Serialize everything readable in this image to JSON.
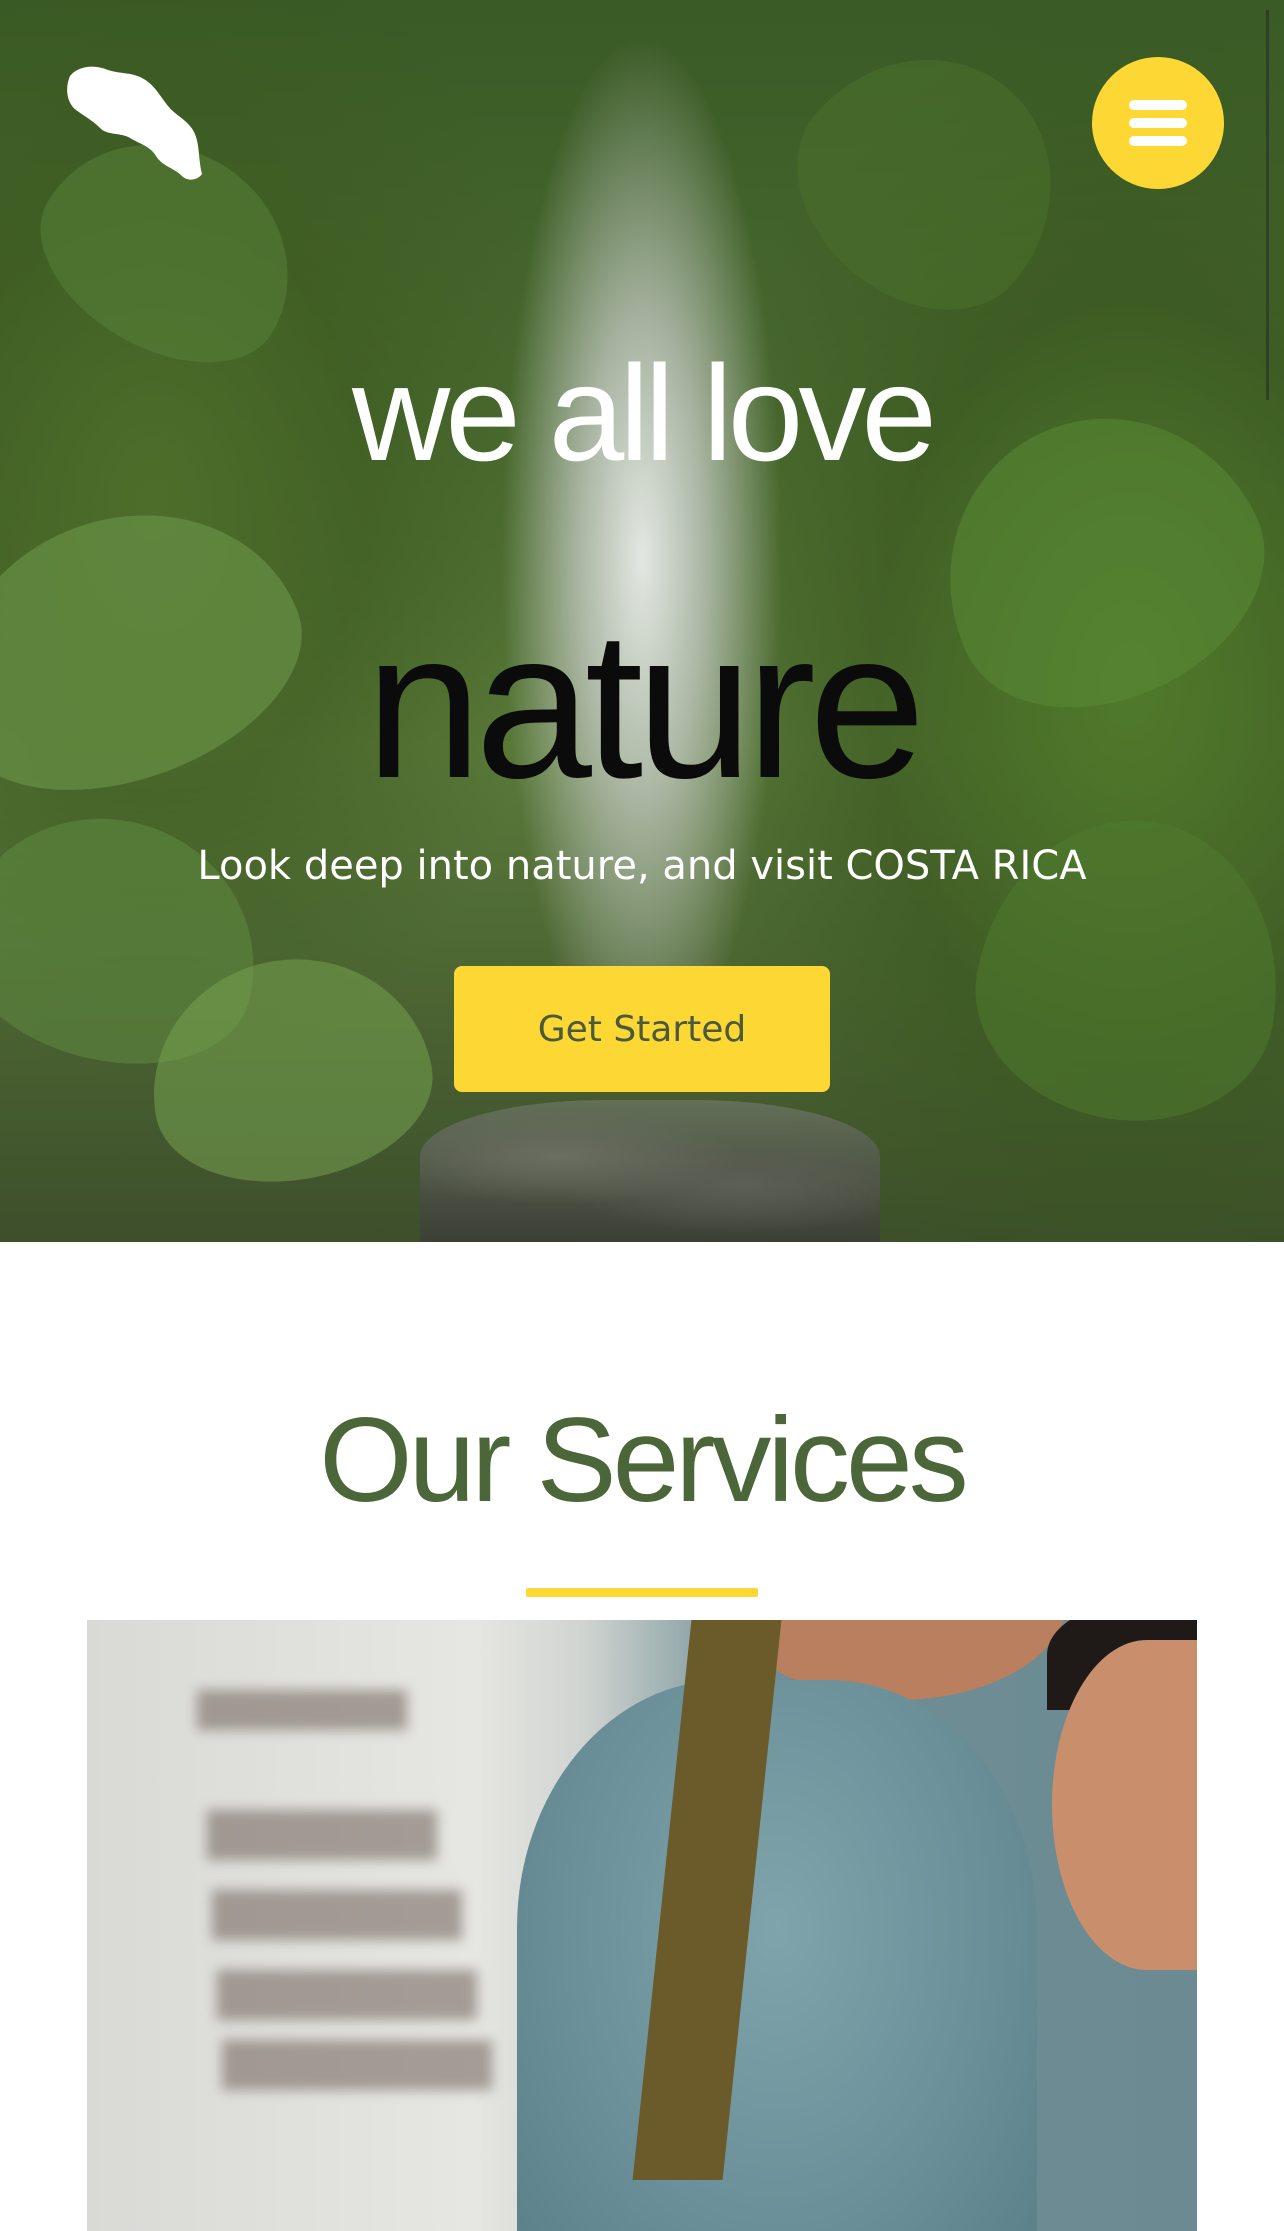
{
  "hero": {
    "line1": "we all love",
    "line2": "nature",
    "subtitle": "Look deep into nature, and visit COSTA RICA",
    "cta_label": "Get Started"
  },
  "header": {
    "logo_icon": "costa-rica-map-icon",
    "menu_icon": "hamburger-menu-icon"
  },
  "services": {
    "title": "Our Services"
  },
  "colors": {
    "accent": "#fdd835",
    "heading_green": "#4b6638",
    "hero_dark_text": "#0b0b0b"
  }
}
